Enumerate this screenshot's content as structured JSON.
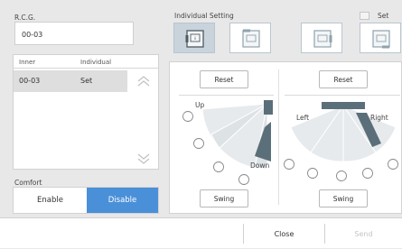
{
  "rcg": {
    "label": "R.C.G.",
    "value": "00-03"
  },
  "list": {
    "headers": [
      "Inner",
      "Individual"
    ],
    "rows": [
      {
        "inner": "00-03",
        "individual": "Set"
      }
    ]
  },
  "comfort": {
    "label": "Comfort",
    "enable": "Enable",
    "disable": "Disable",
    "selected": "Disable"
  },
  "individual_setting": {
    "label": "Individual Setting",
    "set_label": "Set",
    "selected_unit": 0
  },
  "vertical": {
    "reset": "Reset",
    "up": "Up",
    "down": "Down",
    "swing": "Swing"
  },
  "horizontal": {
    "reset": "Reset",
    "left": "Left",
    "right": "Right",
    "swing": "Swing"
  },
  "footer": {
    "close": "Close",
    "send": "Send"
  },
  "colors": {
    "accent": "#4a90d9",
    "louver": "#5b6f7a",
    "fan": "#e4e8ea"
  }
}
